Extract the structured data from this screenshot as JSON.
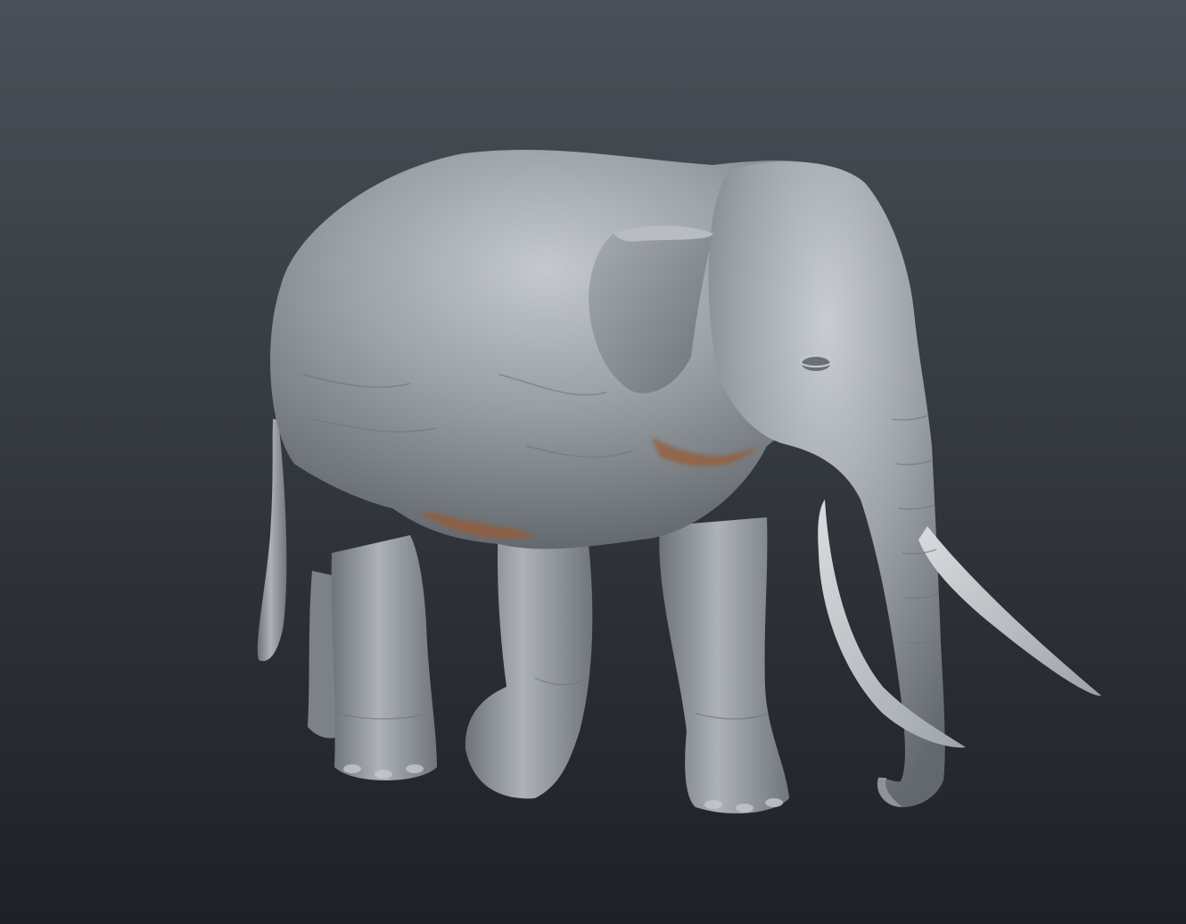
{
  "scene": {
    "subject": "elephant-sculpt",
    "colors": {
      "background_top": "#4a5058",
      "background_bottom": "#1e2126",
      "skin_light": "#b9bec3",
      "skin_mid": "#8f959b",
      "skin_dark": "#5f656b",
      "tusk": "#c9cdd1",
      "cavity_tint": "#b5652f"
    }
  }
}
